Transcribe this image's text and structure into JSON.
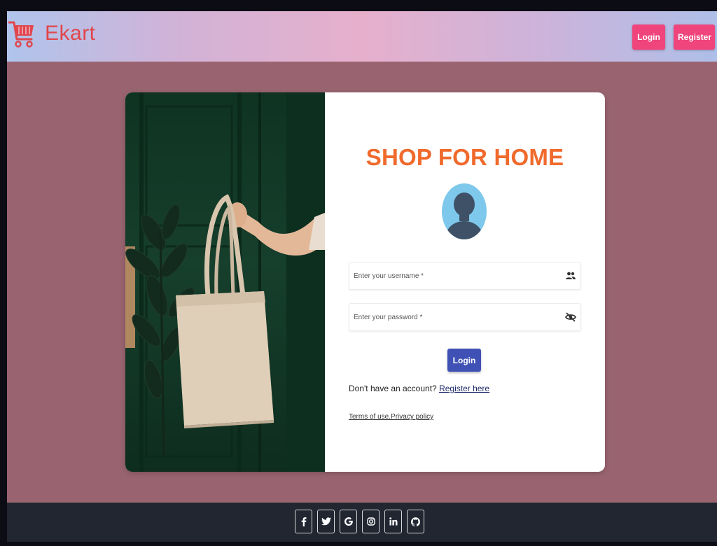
{
  "header": {
    "brand_name": "Ekart",
    "brand_icon": "shopping-cart-icon",
    "login_label": "Login",
    "register_label": "Register"
  },
  "colors": {
    "brand": "#e0474c",
    "header_button": "#f0447c",
    "title": "#f06a2c",
    "primary_button": "#3f51b5",
    "page_background": "#996470",
    "footer_background": "#212631"
  },
  "form": {
    "title": "SHOP FOR HOME",
    "avatar_icon": "user-avatar-icon",
    "username_placeholder": "Enter your username *",
    "username_value": "",
    "username_icon": "people-icon",
    "password_placeholder": "Enter your password *",
    "password_value": "",
    "password_icon": "eye-off-icon",
    "login_label": "Login",
    "signup_prompt": "Don't have an account?",
    "signup_link": "Register here",
    "terms_link": "Terms of use.",
    "privacy_link": "Privacy policy"
  },
  "footer": {
    "social": [
      {
        "name": "facebook",
        "icon": "facebook-icon"
      },
      {
        "name": "twitter",
        "icon": "twitter-icon"
      },
      {
        "name": "google",
        "icon": "google-icon"
      },
      {
        "name": "instagram",
        "icon": "instagram-icon"
      },
      {
        "name": "linkedin",
        "icon": "linkedin-icon"
      },
      {
        "name": "github",
        "icon": "github-icon"
      }
    ]
  }
}
